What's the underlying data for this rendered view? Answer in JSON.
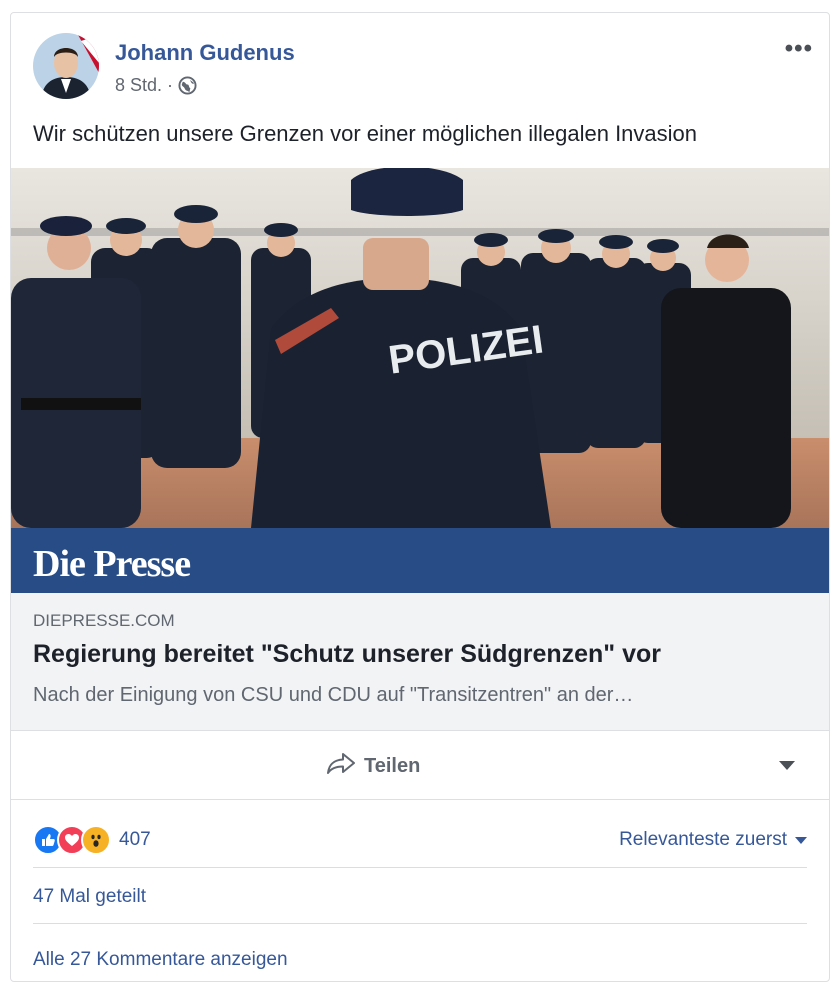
{
  "post": {
    "author": "Johann Gudenus",
    "time": "8 Std. ·",
    "audience_icon": "globe-icon",
    "more_icon": "more-options-icon",
    "more_label": "•••",
    "text": "Wir schützen unsere Grenzen vor einer möglichen illegalen Invasion"
  },
  "photo": {
    "back_label": "POLIZEI",
    "banner_title": "Die Presse"
  },
  "link": {
    "domain": "DIEPRESSE.COM",
    "headline": "Regierung bereitet \"Schutz unserer Südgrenzen\" vor",
    "description": "Nach der Einigung von CSU und CDU auf \"Transitzentren\" an der…"
  },
  "actions": {
    "share_label": "Teilen",
    "share_icon": "share-arrow-icon",
    "dropdown_icon": "chevron-down-icon"
  },
  "reactions": {
    "types": [
      "like",
      "love",
      "wow"
    ],
    "count": "407",
    "sort_label": "Relevanteste zuerst"
  },
  "stats": {
    "shares": "47 Mal geteilt",
    "comments": "Alle 27 Kommentare anzeigen"
  },
  "colors": {
    "link_blue": "#365899",
    "banner_blue": "#284d86",
    "like_blue": "#1877f2",
    "love_red": "#f33e58",
    "wow_yellow": "#f7b125"
  }
}
